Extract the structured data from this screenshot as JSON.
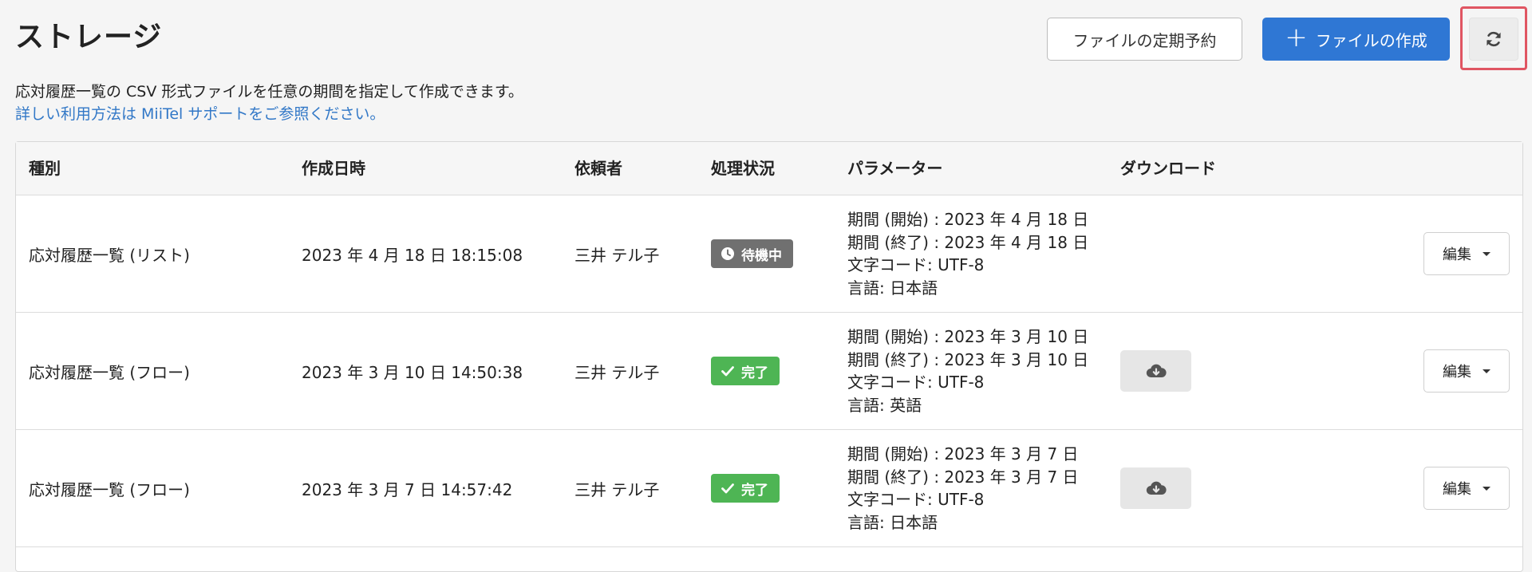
{
  "header": {
    "title": "ストレージ",
    "schedule_button_label": "ファイルの定期予約",
    "create_button_icon": "plus-icon",
    "create_button_label": "ファイルの作成",
    "refresh_icon": "refresh-icon",
    "highlight_color": "#e05562",
    "accent_color": "#2f77d4"
  },
  "description": "応対履歴一覧の CSV 形式ファイルを任意の期間を指定して作成できます。",
  "help_link": "詳しい利用方法は MiiTel サポートをご参照ください。",
  "table": {
    "columns": [
      "種別",
      "作成日時",
      "依頼者",
      "処理状況",
      "パラメーター",
      "ダウンロード"
    ],
    "rows": [
      {
        "type": "応対履歴一覧 (リスト)",
        "created_at": "2023 年 4 月 18 日 18:15:08",
        "requester": "三井 テル子",
        "status": {
          "label": "待機中",
          "icon": "clock-icon",
          "color": "#707070"
        },
        "params": [
          "期間 (開始) : 2023 年 4 月 18 日",
          "期間 (終了) : 2023 年 4 月 18 日",
          "文字コード: UTF-8",
          "言語: 日本語"
        ],
        "download_available": false,
        "edit_label": "編集"
      },
      {
        "type": "応対履歴一覧 (フロー)",
        "created_at": "2023 年 3 月 10 日 14:50:38",
        "requester": "三井 テル子",
        "status": {
          "label": "完了",
          "icon": "check-icon",
          "color": "#4eb554"
        },
        "params": [
          "期間 (開始) : 2023 年 3 月 10 日",
          "期間 (終了) : 2023 年 3 月 10 日",
          "文字コード: UTF-8",
          "言語: 英語"
        ],
        "download_available": true,
        "edit_label": "編集"
      },
      {
        "type": "応対履歴一覧 (フロー)",
        "created_at": "2023 年 3 月 7 日 14:57:42",
        "requester": "三井 テル子",
        "status": {
          "label": "完了",
          "icon": "check-icon",
          "color": "#4eb554"
        },
        "params": [
          "期間 (開始) : 2023 年 3 月 7 日",
          "期間 (終了) : 2023 年 3 月 7 日",
          "文字コード: UTF-8",
          "言語: 日本語"
        ],
        "download_available": true,
        "edit_label": "編集"
      }
    ]
  }
}
